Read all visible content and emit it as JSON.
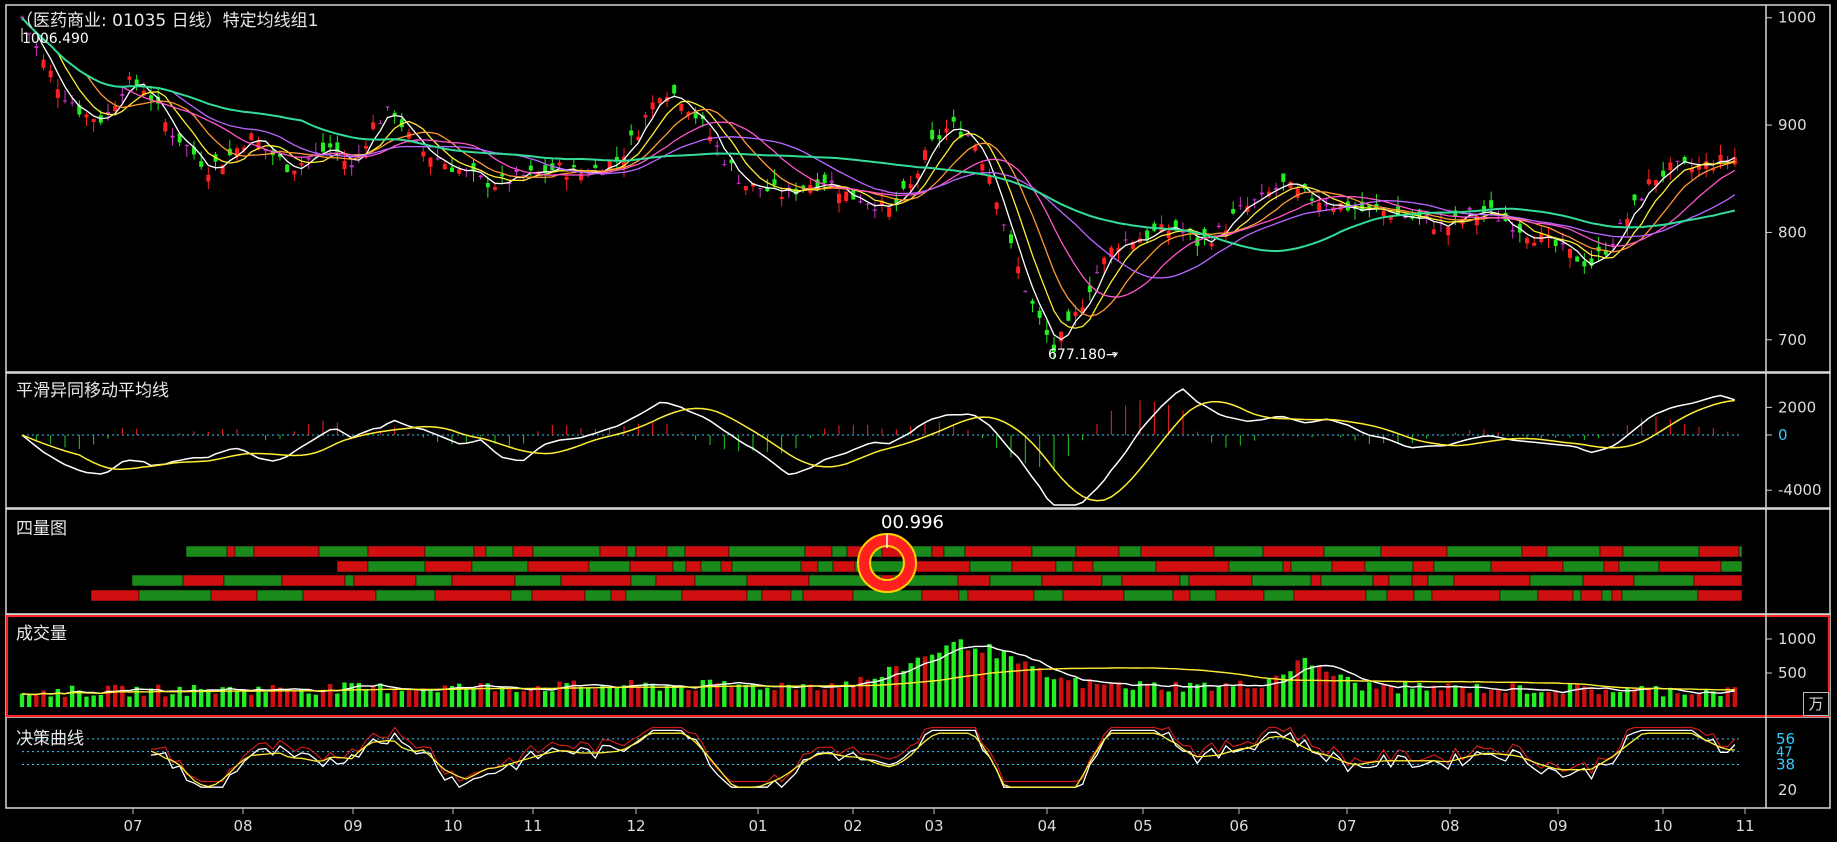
{
  "panes": {
    "price": {
      "title": "（医药商业: 01035 日线）特定均线组1",
      "high_label": "1006.490",
      "low_label": "677.180→",
      "y_ticks": [
        "1000",
        "900",
        "800",
        "700"
      ]
    },
    "macd": {
      "title": "平滑异同移动平均线",
      "y_ticks": [
        "2000",
        "0",
        "-4000"
      ]
    },
    "quad": {
      "title": "四量图",
      "ring_value": "0.996",
      "ring_prefix": "0"
    },
    "volume": {
      "title": "成交量",
      "y_ticks": [
        "1000",
        "500"
      ],
      "unit": "万"
    },
    "decision": {
      "title": "决策曲线",
      "y_ticks": [
        "56",
        "38",
        "20"
      ],
      "extra_ticks": [
        "56",
        "38"
      ]
    }
  },
  "x_axis": {
    "labels": [
      "07",
      "08",
      "09",
      "10",
      "11",
      "12",
      "01",
      "02",
      "03",
      "04",
      "05",
      "06",
      "07",
      "08",
      "09",
      "10",
      "11"
    ]
  },
  "chart_data": {
    "type": "candlestick",
    "title": "（医药商业: 01035 日线）特定均线组1",
    "y_range": [
      670,
      1010
    ],
    "high": 1006.49,
    "low": 677.18,
    "price_path": [
      1000,
      960,
      930,
      910,
      905,
      940,
      935,
      900,
      880,
      860,
      870,
      890,
      875,
      860,
      870,
      880,
      860,
      900,
      915,
      880,
      870,
      860,
      850,
      845,
      850,
      855,
      860,
      855,
      860,
      870,
      900,
      935,
      925,
      900,
      870,
      845,
      840,
      835,
      845,
      850,
      835,
      830,
      820,
      840,
      880,
      900,
      890,
      850,
      780,
      730,
      690,
      720,
      760,
      790,
      795,
      800,
      805,
      790,
      800,
      820,
      830,
      845,
      835,
      830,
      825,
      820,
      820,
      815,
      810,
      805,
      815,
      820,
      810,
      800,
      790,
      780,
      770,
      790,
      820,
      850,
      860,
      860,
      865,
      870
    ],
    "colors": {
      "up": "#ff2020",
      "down": "#22ee22",
      "flat": "#cc33cc",
      "ma_long": "#33dd99"
    }
  }
}
